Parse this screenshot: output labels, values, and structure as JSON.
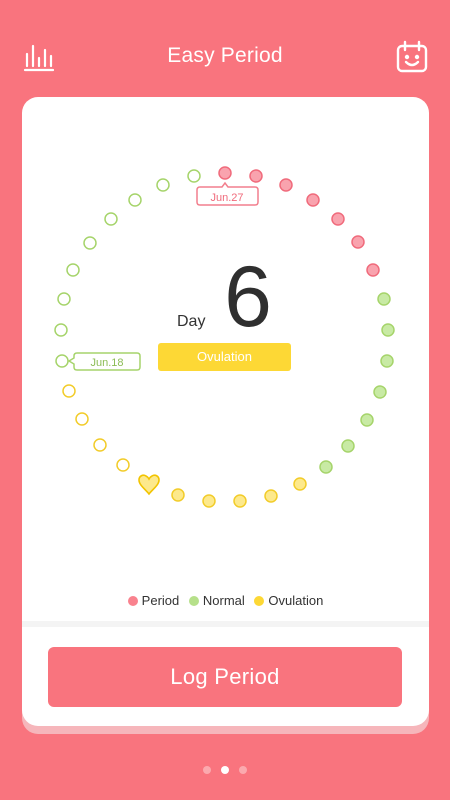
{
  "header": {
    "title": "Easy Period",
    "left_icon": "bar-chart-icon",
    "right_icon": "calendar-smile-icon"
  },
  "cycle": {
    "day_label": "Day",
    "day_number": "6",
    "phase": "Ovulation",
    "marker_start_label": "Jun.27",
    "marker_end_label": "Jun.18",
    "heart_icon": "heart-icon"
  },
  "legend": [
    {
      "label": "Period",
      "color": "#f9828e"
    },
    {
      "label": "Normal",
      "color": "#b6e08a"
    },
    {
      "label": "Ovulation",
      "color": "#fdd835"
    }
  ],
  "log_button_label": "Log Period",
  "pager": {
    "count": 3,
    "active": 1
  },
  "colors": {
    "brand": "#f9747e",
    "period_fill": "#f9a3ae",
    "period_stroke": "#f06b7c",
    "normal": "#a6d46b",
    "normal_fill": "#c8eaa4",
    "ovulation": "#fdd835",
    "ovulation_fill": "#fde98c"
  }
}
